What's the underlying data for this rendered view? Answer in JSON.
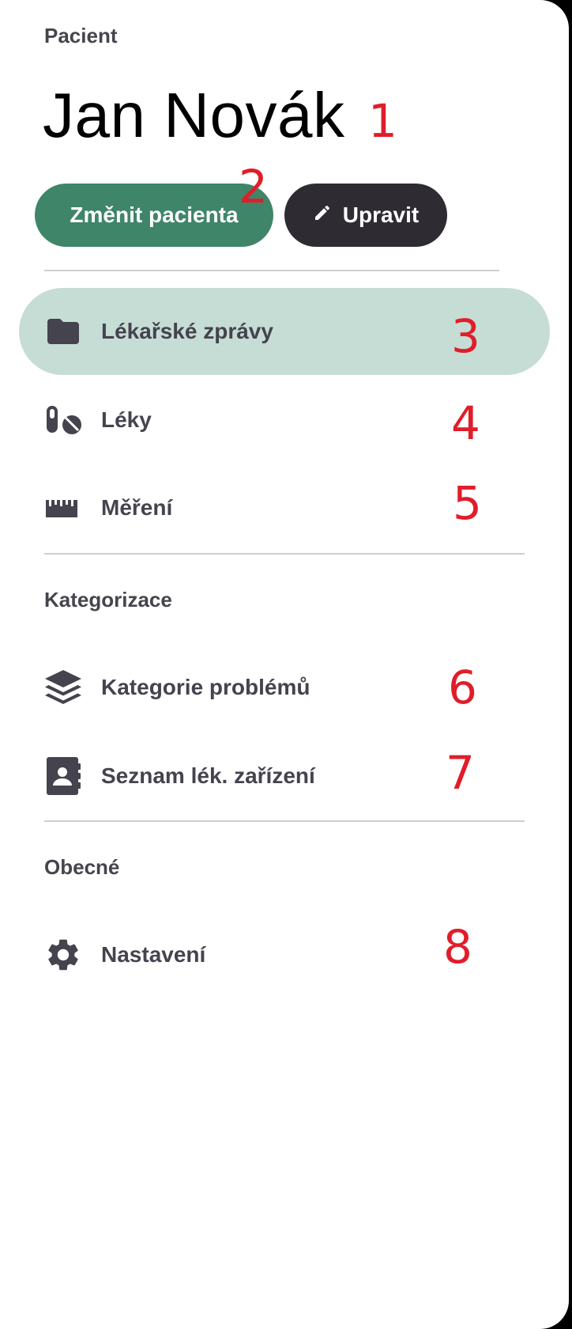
{
  "drawer": {
    "section_label": "Pacient",
    "patient_name": "Jan Novák",
    "buttons": {
      "change_patient": "Změnit pacienta",
      "edit": "Upravit",
      "edit_icon": "pencil-icon"
    },
    "nav_main": [
      {
        "label": "Lékařské zprávy",
        "icon": "folder-icon",
        "active": true
      },
      {
        "label": "Léky",
        "icon": "pills-icon",
        "active": false
      },
      {
        "label": "Měření",
        "icon": "ruler-icon",
        "active": false
      }
    ],
    "categorization": {
      "label": "Kategorizace",
      "items": [
        {
          "label": "Kategorie problémů",
          "icon": "layers-icon"
        },
        {
          "label": "Seznam lék. zařízení",
          "icon": "contact-book-icon"
        }
      ]
    },
    "general": {
      "label": "Obecné",
      "items": [
        {
          "label": "Nastavení",
          "icon": "gear-icon"
        }
      ]
    }
  },
  "markers": [
    "1",
    "2",
    "3",
    "4",
    "5",
    "6",
    "7",
    "8"
  ],
  "colors": {
    "primary_button": "#3f8569",
    "secondary_button": "#2f2b33",
    "active_item": "#c6ddd5",
    "marker": "#e11d2a",
    "icon": "#45434e"
  }
}
